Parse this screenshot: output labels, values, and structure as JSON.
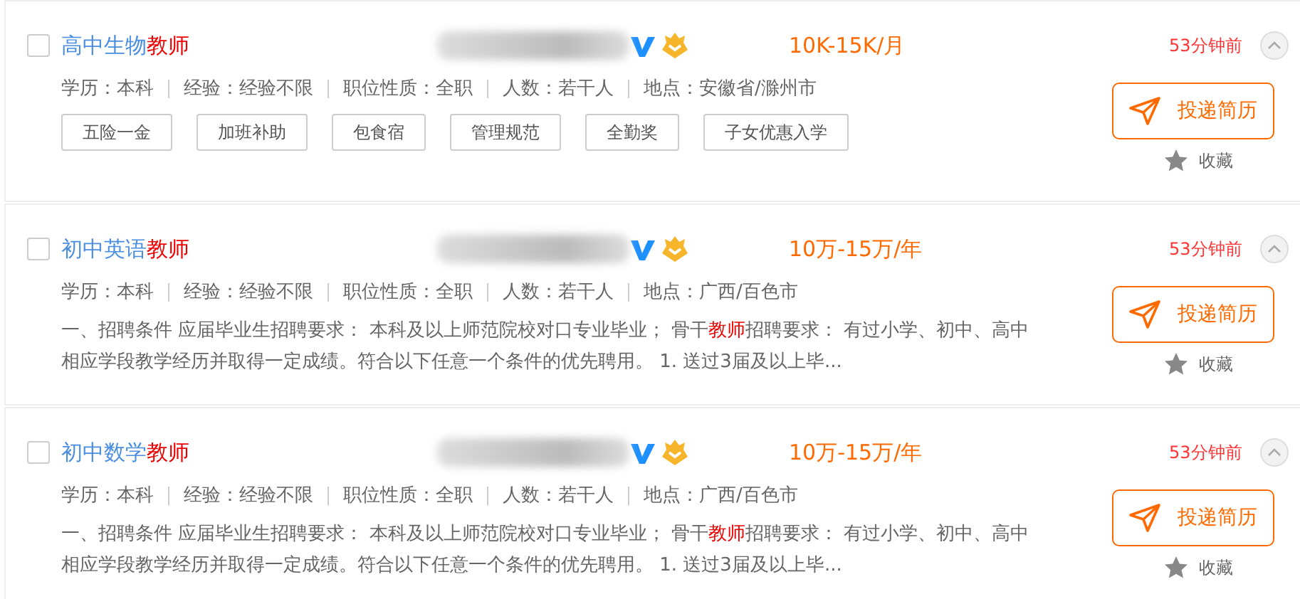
{
  "jobs": [
    {
      "checked": false,
      "title": "高中生物",
      "title_keyword": "教师",
      "salary": "10K-15K/月",
      "posted": "53分钟前",
      "meta": [
        {
          "label": "学历：",
          "value": "本科"
        },
        {
          "label": "经验：",
          "value": "经验不限"
        },
        {
          "label": "职位性质：",
          "value": "全职"
        },
        {
          "label": "人数：",
          "value": "若干人"
        },
        {
          "label": "地点：",
          "value": "安徽省/滁州市"
        }
      ],
      "tags": [
        "五险一金",
        "加班补助",
        "包食宿",
        "管理规范",
        "全勤奖",
        "子女优惠入学"
      ],
      "apply": "投递简历",
      "favorite": "收藏"
    },
    {
      "checked": false,
      "title": "初中英语",
      "title_keyword": "教师",
      "salary": "10万-15万/年",
      "posted": "53分钟前",
      "meta": [
        {
          "label": "学历：",
          "value": "本科"
        },
        {
          "label": "经验：",
          "value": "经验不限"
        },
        {
          "label": "职位性质：",
          "value": "全职"
        },
        {
          "label": "人数：",
          "value": "若干人"
        },
        {
          "label": "地点：",
          "value": "广西/百色市"
        }
      ],
      "description": {
        "before": "一、招聘条件 应届毕业生招聘要求：  本科及以上师范院校对口专业毕业；  骨干",
        "keyword": "教师",
        "after": "招聘要求：  有过小学、初中、高中相应学段教学经历并取得一定成绩。符合以下任意一个条件的优先聘用。  1. 送过3届及以上毕..."
      },
      "apply": "投递简历",
      "favorite": "收藏"
    },
    {
      "checked": false,
      "title": "初中数学",
      "title_keyword": "教师",
      "salary": "10万-15万/年",
      "posted": "53分钟前",
      "meta": [
        {
          "label": "学历：",
          "value": "本科"
        },
        {
          "label": "经验：",
          "value": "经验不限"
        },
        {
          "label": "职位性质：",
          "value": "全职"
        },
        {
          "label": "人数：",
          "value": "若干人"
        },
        {
          "label": "地点：",
          "value": "广西/百色市"
        }
      ],
      "description": {
        "before": "一、招聘条件 应届毕业生招聘要求：  本科及以上师范院校对口专业毕业；  骨干",
        "keyword": "教师",
        "after": "招聘要求：  有过小学、初中、高中相应学段教学经历并取得一定成绩。符合以下任意一个条件的优先聘用。  1. 送过3届及以上毕..."
      },
      "apply": "投递简历",
      "favorite": "收藏"
    }
  ]
}
